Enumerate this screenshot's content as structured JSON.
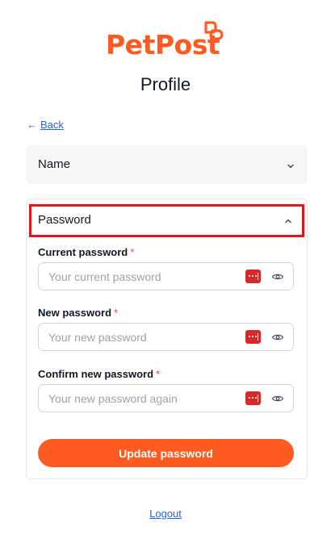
{
  "brand": {
    "name": "PetPost",
    "color": "#ff5a1f",
    "logo_icon": "paw-bubble-icon"
  },
  "page": {
    "title": "Profile"
  },
  "nav": {
    "back_label": "Back",
    "back_icon": "arrow-left-icon"
  },
  "sections": {
    "name": {
      "label": "Name",
      "expanded": false
    },
    "password": {
      "label": "Password",
      "expanded": true,
      "fields": [
        {
          "label": "Current password",
          "required": "*",
          "placeholder": "Your current password",
          "value": ""
        },
        {
          "label": "New password",
          "required": "*",
          "placeholder": "Your new password",
          "value": ""
        },
        {
          "label": "Confirm new password",
          "required": "*",
          "placeholder": "Your new password again",
          "value": ""
        }
      ],
      "submit_label": "Update password"
    }
  },
  "footer": {
    "logout_label": "Logout"
  },
  "colors": {
    "accent": "#ff5a1f",
    "link": "#2563eb",
    "required": "#f43f5e",
    "highlight": "#e2141c",
    "password_manager": "#d42a2a"
  }
}
